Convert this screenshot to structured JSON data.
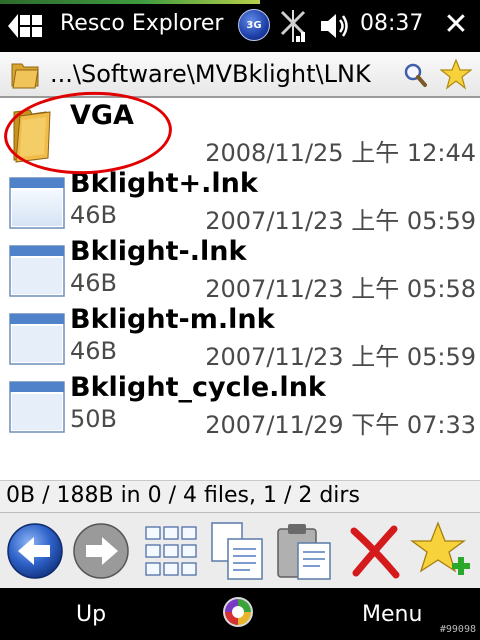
{
  "statusbar": {
    "app_title": "Resco Explorer",
    "network_badge": "3G",
    "time": "08:37",
    "close_glyph": "✕",
    "icons": [
      "windows-start-icon",
      "3g-icon",
      "signal-icon",
      "volume-icon",
      "close-icon"
    ]
  },
  "pathbar": {
    "path": "...\\Software\\MVBklight\\LNK",
    "icons": [
      "folder-icon",
      "search-icon",
      "favorite-star-icon"
    ]
  },
  "files": [
    {
      "name": "VGA",
      "size": "",
      "date": "2008/11/25 上午 12:44",
      "kind": "folder"
    },
    {
      "name": "Bklight+.lnk",
      "size": "46B",
      "date": "2007/11/23 上午 05:59",
      "kind": "file"
    },
    {
      "name": "Bklight-.lnk",
      "size": "46B",
      "date": "2007/11/23 上午 05:58",
      "kind": "file"
    },
    {
      "name": "Bklight-m.lnk",
      "size": "46B",
      "date": "2007/11/23 上午 05:59",
      "kind": "file"
    },
    {
      "name": "Bklight_cycle.lnk",
      "size": "50B",
      "date": "2007/11/29 下午 07:33",
      "kind": "file"
    }
  ],
  "status": {
    "summary": "0B / 188B in 0 / 4 files, 1 / 2 dirs"
  },
  "toolbar": {
    "buttons": [
      "back-arrow-icon",
      "forward-arrow-icon",
      "view-grid-icon",
      "copy-icon",
      "paste-icon",
      "delete-icon",
      "add-favorite-icon"
    ]
  },
  "softkeys": {
    "left": "Up",
    "right": "Menu"
  },
  "watermark": "#99098",
  "colors": {
    "annotation": "#e10000",
    "titlebar": "#000000",
    "statusbar_strip": "#3f9b3f"
  }
}
